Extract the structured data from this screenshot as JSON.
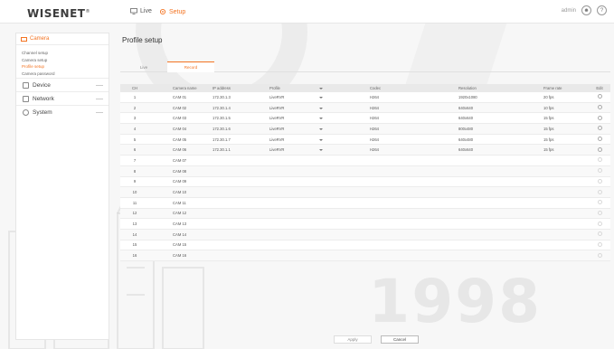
{
  "header": {
    "logo": "WISENET",
    "logo_mark": "®",
    "nav": [
      {
        "label": "Live",
        "icon": "monitor-icon"
      },
      {
        "label": "Setup",
        "icon": "gear-icon"
      }
    ],
    "user": "admin",
    "user_icon": "user-icon",
    "help_icon": "help-icon"
  },
  "sidebar": {
    "sections": [
      {
        "label": "Camera",
        "icon": "camera-icon",
        "expanded": true,
        "items": [
          {
            "label": "Channel setup",
            "active": false
          },
          {
            "label": "Camera setup",
            "active": false
          },
          {
            "label": "Profile setup",
            "active": true
          },
          {
            "label": "Camera password",
            "active": false
          }
        ]
      },
      {
        "label": "Device",
        "icon": "device-icon"
      },
      {
        "label": "Network",
        "icon": "network-icon"
      },
      {
        "label": "System",
        "icon": "system-icon"
      }
    ]
  },
  "main": {
    "title": "Profile setup",
    "tabs": [
      {
        "label": "Live",
        "active": false
      },
      {
        "label": "Record",
        "active": true
      }
    ],
    "columns": [
      "CH",
      "Camera name",
      "IP address",
      "Profile",
      "",
      "Codec",
      "Resolution",
      "Frame rate",
      "Edit"
    ],
    "rows": [
      {
        "ch": "1",
        "name": "CAM 01",
        "ip": "172.30.1.3",
        "profile": "LiveRVR",
        "codec": "H264",
        "res": "1920x1080",
        "fps": "20 fps"
      },
      {
        "ch": "2",
        "name": "CAM 02",
        "ip": "172.30.1.4",
        "profile": "LiveRVR",
        "codec": "H264",
        "res": "640x640",
        "fps": "10 fps"
      },
      {
        "ch": "3",
        "name": "CAM 03",
        "ip": "172.30.1.5",
        "profile": "LiveRVR",
        "codec": "H264",
        "res": "640x640",
        "fps": "15 fps"
      },
      {
        "ch": "4",
        "name": "CAM 04",
        "ip": "172.30.1.6",
        "profile": "LiveRVR",
        "codec": "H264",
        "res": "800x480",
        "fps": "15 fps"
      },
      {
        "ch": "5",
        "name": "CAM 05",
        "ip": "172.30.1.7",
        "profile": "LiveRVR",
        "codec": "H264",
        "res": "640x480",
        "fps": "15 fps"
      },
      {
        "ch": "6",
        "name": "CAM 06",
        "ip": "172.30.1.1",
        "profile": "LiveRVR",
        "codec": "H264",
        "res": "640x640",
        "fps": "15 fps"
      },
      {
        "ch": "7",
        "name": "CAM 07",
        "ip": "",
        "profile": "",
        "codec": "",
        "res": "",
        "fps": ""
      },
      {
        "ch": "8",
        "name": "CAM 08",
        "ip": "",
        "profile": "",
        "codec": "",
        "res": "",
        "fps": ""
      },
      {
        "ch": "9",
        "name": "CAM 09",
        "ip": "",
        "profile": "",
        "codec": "",
        "res": "",
        "fps": ""
      },
      {
        "ch": "10",
        "name": "CAM 10",
        "ip": "",
        "profile": "",
        "codec": "",
        "res": "",
        "fps": ""
      },
      {
        "ch": "11",
        "name": "CAM 11",
        "ip": "",
        "profile": "",
        "codec": "",
        "res": "",
        "fps": ""
      },
      {
        "ch": "12",
        "name": "CAM 12",
        "ip": "",
        "profile": "",
        "codec": "",
        "res": "",
        "fps": ""
      },
      {
        "ch": "13",
        "name": "CAM 13",
        "ip": "",
        "profile": "",
        "codec": "",
        "res": "",
        "fps": ""
      },
      {
        "ch": "14",
        "name": "CAM 14",
        "ip": "",
        "profile": "",
        "codec": "",
        "res": "",
        "fps": ""
      },
      {
        "ch": "15",
        "name": "CAM 15",
        "ip": "",
        "profile": "",
        "codec": "",
        "res": "",
        "fps": ""
      },
      {
        "ch": "16",
        "name": "CAM 16",
        "ip": "",
        "profile": "",
        "codec": "",
        "res": "",
        "fps": ""
      }
    ]
  },
  "footer": {
    "apply": "Apply",
    "cancel": "Cancel"
  },
  "watermark": {
    "year": "1998"
  },
  "colors": {
    "accent": "#f37321",
    "text": "#444444",
    "header_bg": "#e9e9e9"
  }
}
